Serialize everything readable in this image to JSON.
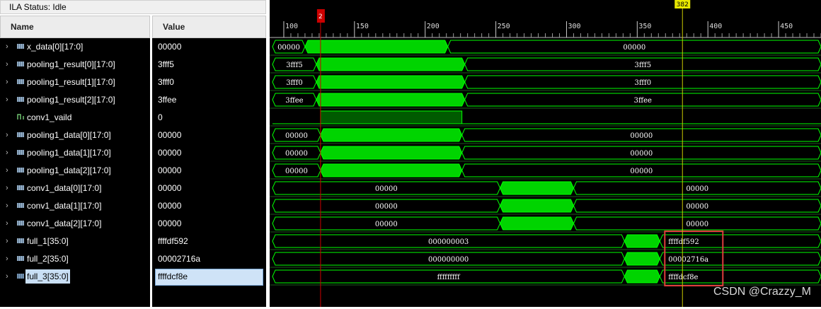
{
  "ila_status": "ILA Status:  Idle",
  "columns": {
    "name": "Name",
    "value": "Value"
  },
  "signals": [
    {
      "name": "x_data[0][17:0]",
      "value": "00000",
      "type": "bus"
    },
    {
      "name": "pooling1_result[0][17:0]",
      "value": "3fff5",
      "type": "bus"
    },
    {
      "name": "pooling1_result[1][17:0]",
      "value": "3fff0",
      "type": "bus"
    },
    {
      "name": "pooling1_result[2][17:0]",
      "value": "3ffee",
      "type": "bus"
    },
    {
      "name": "conv1_vaild",
      "value": "0",
      "type": "bit"
    },
    {
      "name": "pooling1_data[0][17:0]",
      "value": "00000",
      "type": "bus"
    },
    {
      "name": "pooling1_data[1][17:0]",
      "value": "00000",
      "type": "bus"
    },
    {
      "name": "pooling1_data[2][17:0]",
      "value": "00000",
      "type": "bus"
    },
    {
      "name": "conv1_data[0][17:0]",
      "value": "00000",
      "type": "bus"
    },
    {
      "name": "conv1_data[1][17:0]",
      "value": "00000",
      "type": "bus"
    },
    {
      "name": "conv1_data[2][17:0]",
      "value": "00000",
      "type": "bus"
    },
    {
      "name": "full_1[35:0]",
      "value": "ffffdf592",
      "type": "bus"
    },
    {
      "name": "full_2[35:0]",
      "value": "00002716a",
      "type": "bus"
    },
    {
      "name": "full_3[35:0]",
      "value": "ffffdcf8e",
      "type": "bus",
      "selected": true
    }
  ],
  "timeline": {
    "ticks": [
      "100",
      "150",
      "200",
      "250",
      "300",
      "350",
      "400",
      "450"
    ],
    "start": 92,
    "end": 480,
    "trigger_marker": "2",
    "trigger_time": 126,
    "cursor_label": "382",
    "cursor_time": 382
  },
  "waveforms": [
    {
      "segments": [
        {
          "from": 92,
          "to": 115,
          "label": "00000"
        },
        {
          "from": 115,
          "to": 216,
          "active": true
        },
        {
          "from": 216,
          "to": 480,
          "label": "00000"
        }
      ]
    },
    {
      "segments": [
        {
          "from": 92,
          "to": 123,
          "label": "3fff5"
        },
        {
          "from": 123,
          "to": 228,
          "active": true
        },
        {
          "from": 228,
          "to": 480,
          "label": "3fff5"
        }
      ]
    },
    {
      "segments": [
        {
          "from": 92,
          "to": 123,
          "label": "3fff0"
        },
        {
          "from": 123,
          "to": 228,
          "active": true
        },
        {
          "from": 228,
          "to": 480,
          "label": "3fff0"
        }
      ]
    },
    {
      "segments": [
        {
          "from": 92,
          "to": 123,
          "label": "3ffee"
        },
        {
          "from": 123,
          "to": 228,
          "active": true
        },
        {
          "from": 228,
          "to": 480,
          "label": "3ffee"
        }
      ]
    },
    {
      "bit": true,
      "high_from": 126,
      "high_to": 226
    },
    {
      "segments": [
        {
          "from": 92,
          "to": 126,
          "label": "00000"
        },
        {
          "from": 126,
          "to": 226,
          "active": true
        },
        {
          "from": 226,
          "to": 480,
          "label": "00000"
        }
      ]
    },
    {
      "segments": [
        {
          "from": 92,
          "to": 126,
          "label": "00000"
        },
        {
          "from": 126,
          "to": 226,
          "active": true
        },
        {
          "from": 226,
          "to": 480,
          "label": "00000"
        }
      ]
    },
    {
      "segments": [
        {
          "from": 92,
          "to": 126,
          "label": "00000"
        },
        {
          "from": 126,
          "to": 226,
          "active": true
        },
        {
          "from": 226,
          "to": 480,
          "label": "00000"
        }
      ]
    },
    {
      "segments": [
        {
          "from": 92,
          "to": 253,
          "label": "00000"
        },
        {
          "from": 253,
          "to": 305,
          "active": true
        },
        {
          "from": 305,
          "to": 480,
          "label": "00000"
        }
      ]
    },
    {
      "segments": [
        {
          "from": 92,
          "to": 253,
          "label": "00000"
        },
        {
          "from": 253,
          "to": 305,
          "active": true
        },
        {
          "from": 305,
          "to": 480,
          "label": "00000"
        }
      ]
    },
    {
      "segments": [
        {
          "from": 92,
          "to": 253,
          "label": "00000"
        },
        {
          "from": 253,
          "to": 305,
          "active": true
        },
        {
          "from": 305,
          "to": 480,
          "label": "00000"
        }
      ]
    },
    {
      "segments": [
        {
          "from": 92,
          "to": 341,
          "label": "000000003"
        },
        {
          "from": 341,
          "to": 366,
          "active": true
        },
        {
          "from": 366,
          "to": 480,
          "label": "ffffdf592",
          "boxed": true
        }
      ]
    },
    {
      "segments": [
        {
          "from": 92,
          "to": 341,
          "label": "000000000"
        },
        {
          "from": 341,
          "to": 366,
          "active": true
        },
        {
          "from": 366,
          "to": 480,
          "label": "00002716a",
          "boxed": true
        }
      ]
    },
    {
      "segments": [
        {
          "from": 92,
          "to": 341,
          "label": "fffffffff"
        },
        {
          "from": 341,
          "to": 366,
          "active": true
        },
        {
          "from": 366,
          "to": 480,
          "label": "ffffdcf8e",
          "boxed": true
        }
      ]
    }
  ],
  "watermark": "CSDN @Crazzy_M",
  "colors": {
    "wave": "#00ff00",
    "active_fill": "#00d400",
    "bit_high": "#005a00",
    "trigger": "#cc0000",
    "cursor": "#c8c800",
    "highlight_box": "#e03c3c"
  }
}
